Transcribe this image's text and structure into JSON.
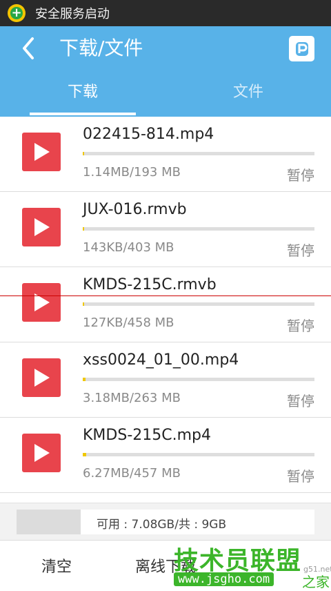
{
  "status_bar": {
    "text": "安全服务启动"
  },
  "header": {
    "title": "下载/文件"
  },
  "tabs": [
    {
      "label": "下载"
    },
    {
      "label": "文件"
    }
  ],
  "downloads": [
    {
      "name": "022415-814.mp4",
      "size": "1.14MB/193 MB",
      "action": "暂停",
      "progress": 0.006
    },
    {
      "name": "JUX-016.rmvb",
      "size": "143KB/403 MB",
      "action": "暂停",
      "progress": 0.0004
    },
    {
      "name": "KMDS-215C.rmvb",
      "size": "127KB/458 MB",
      "action": "暂停",
      "progress": 0.0003
    },
    {
      "name": "xss0024_01_00.mp4",
      "size": "3.18MB/263 MB",
      "action": "暂停",
      "progress": 0.012
    },
    {
      "name": "KMDS-215C.mp4",
      "size": "6.27MB/457 MB",
      "action": "暂停",
      "progress": 0.014
    }
  ],
  "storage": {
    "text": "可用 : 7.08GB/共 : 9GB"
  },
  "bottom": {
    "clear": "清空",
    "offline": "离线下载"
  },
  "watermark": {
    "title": "技术员联盟",
    "url": "www.jsgho.com",
    "suffix": "之家",
    "small": "g51.net"
  },
  "colors": {
    "header": "#58b2e8",
    "thumb": "#e8444c",
    "progress": "#f0c800"
  }
}
